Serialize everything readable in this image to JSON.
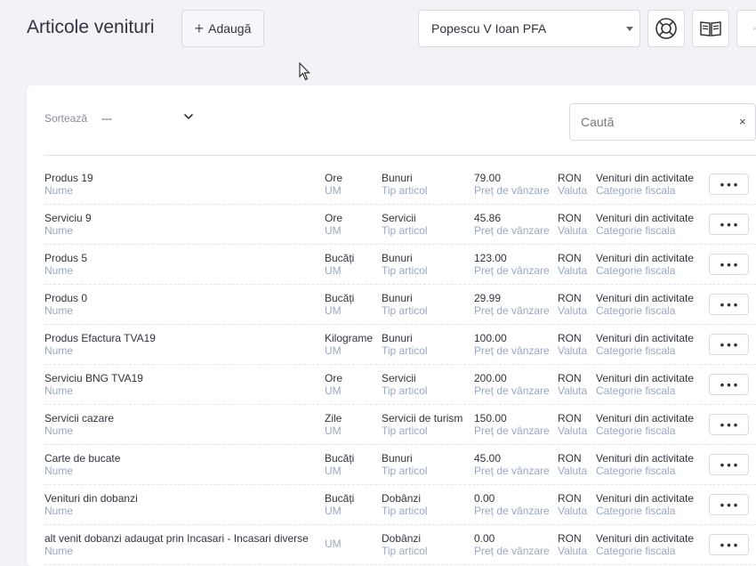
{
  "header": {
    "title": "Articole venituri",
    "add_label": "Adaugă",
    "company": "Popescu V Ioan PFA"
  },
  "toolbar": {
    "sort_label": "Sortează",
    "sort_value": "---",
    "search_placeholder": "Caută",
    "clear_symbol": "×"
  },
  "column_labels": {
    "name": "Nume",
    "um": "UM",
    "tip": "Tip articol",
    "pret": "Preț de vânzare",
    "valuta": "Valuta",
    "categorie": "Categorie fiscala"
  },
  "rows": [
    {
      "name": "Produs 19",
      "um": "Ore",
      "tip": "Bunuri",
      "pret": "79.00",
      "valuta": "RON",
      "categorie": "Venituri din activitate"
    },
    {
      "name": "Serviciu 9",
      "um": "Ore",
      "tip": "Servicii",
      "pret": "45.86",
      "valuta": "RON",
      "categorie": "Venituri din activitate"
    },
    {
      "name": "Produs 5",
      "um": "Bucăți",
      "tip": "Bunuri",
      "pret": "123.00",
      "valuta": "RON",
      "categorie": "Venituri din activitate"
    },
    {
      "name": "Produs 0",
      "um": "Bucăți",
      "tip": "Bunuri",
      "pret": "29.99",
      "valuta": "RON",
      "categorie": "Venituri din activitate"
    },
    {
      "name": "Produs Efactura TVA19",
      "um": "Kilograme",
      "tip": "Bunuri",
      "pret": "100.00",
      "valuta": "RON",
      "categorie": "Venituri din activitate"
    },
    {
      "name": "Serviciu BNG TVA19",
      "um": "Ore",
      "tip": "Servicii",
      "pret": "200.00",
      "valuta": "RON",
      "categorie": "Venituri din activitate"
    },
    {
      "name": "Servicii cazare",
      "um": "Zile",
      "tip": "Servicii de turism",
      "pret": "150.00",
      "valuta": "RON",
      "categorie": "Venituri din activitate"
    },
    {
      "name": "Carte de bucate",
      "um": "Bucăți",
      "tip": "Bunuri",
      "pret": "45.00",
      "valuta": "RON",
      "categorie": "Venituri din activitate"
    },
    {
      "name": "Venituri din dobanzi",
      "um": "Bucăți",
      "tip": "Dobânzi",
      "pret": "0.00",
      "valuta": "RON",
      "categorie": "Venituri din activitate"
    },
    {
      "name": "alt venit dobanzi adaugat prin Incasari - Incasari diverse",
      "um": "",
      "tip": "Dobânzi",
      "pret": "0.00",
      "valuta": "RON",
      "categorie": "Venituri din activitate"
    }
  ],
  "icons": {
    "support": "lifebuoy-icon",
    "guide": "open-book-icon",
    "notifications": "bell-icon"
  }
}
